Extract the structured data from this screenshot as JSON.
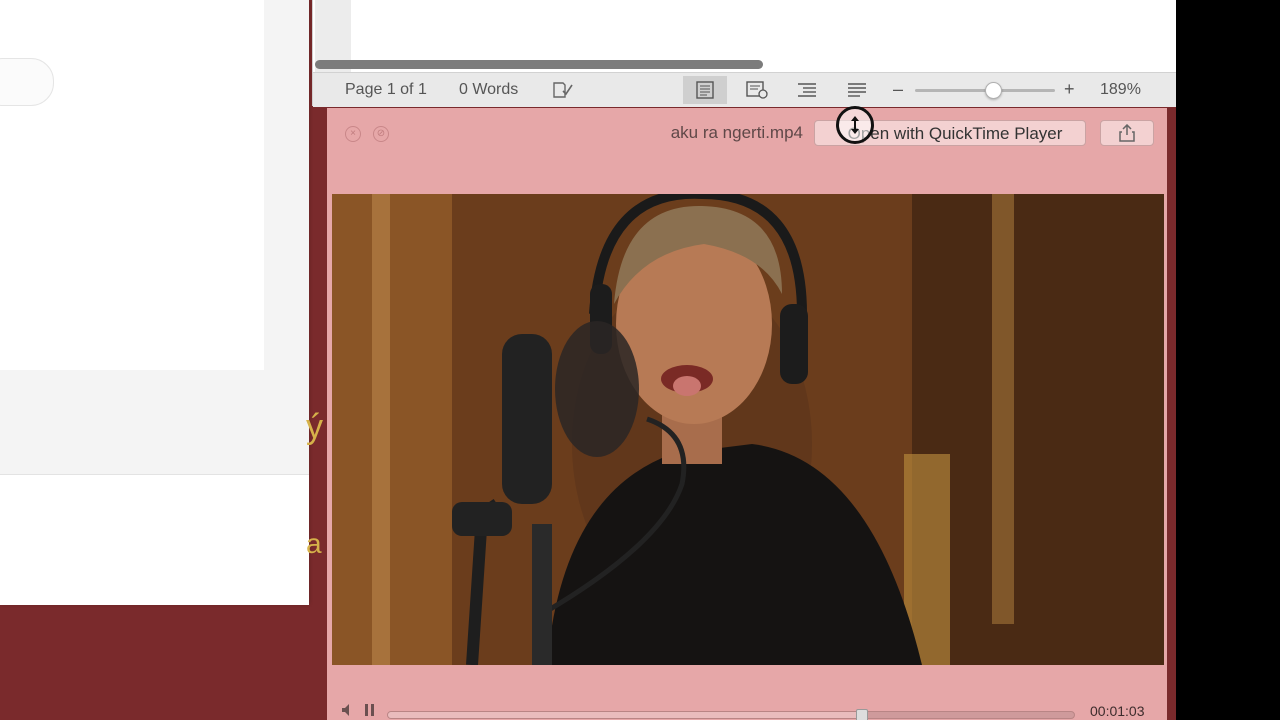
{
  "left_window": {
    "glyph_top": "ý",
    "glyph_bottom": "a"
  },
  "doc_window": {
    "status_bar": {
      "page_label": "Page 1 of 1",
      "words_label": "0 Words",
      "zoom_minus": "–",
      "zoom_plus": "+",
      "zoom_percent": "189%",
      "zoom_level_fraction": 0.55,
      "views": [
        "print-layout-icon",
        "web-layout-icon",
        "outline-icon",
        "draft-icon"
      ]
    }
  },
  "quick_look": {
    "filename": "aku ra ngerti.mp4",
    "open_button": "Open with QuickTime Player",
    "close_glyph": "×",
    "fullscreen_glyph": "⊘",
    "share_icon": "share-icon",
    "playback": {
      "current_time": "00:01:03",
      "progress_fraction": 0.69,
      "volume_icon": "speaker-icon",
      "pause_icon": "pause-icon"
    },
    "video_description_icon": "video-frame"
  },
  "cursor": {
    "icon": "resize-vertical-cursor-icon"
  },
  "colors": {
    "desktop": "#7a2a2c",
    "quicklook_bg": "#e6a7a8",
    "status_bar": "#e9e9e9"
  }
}
